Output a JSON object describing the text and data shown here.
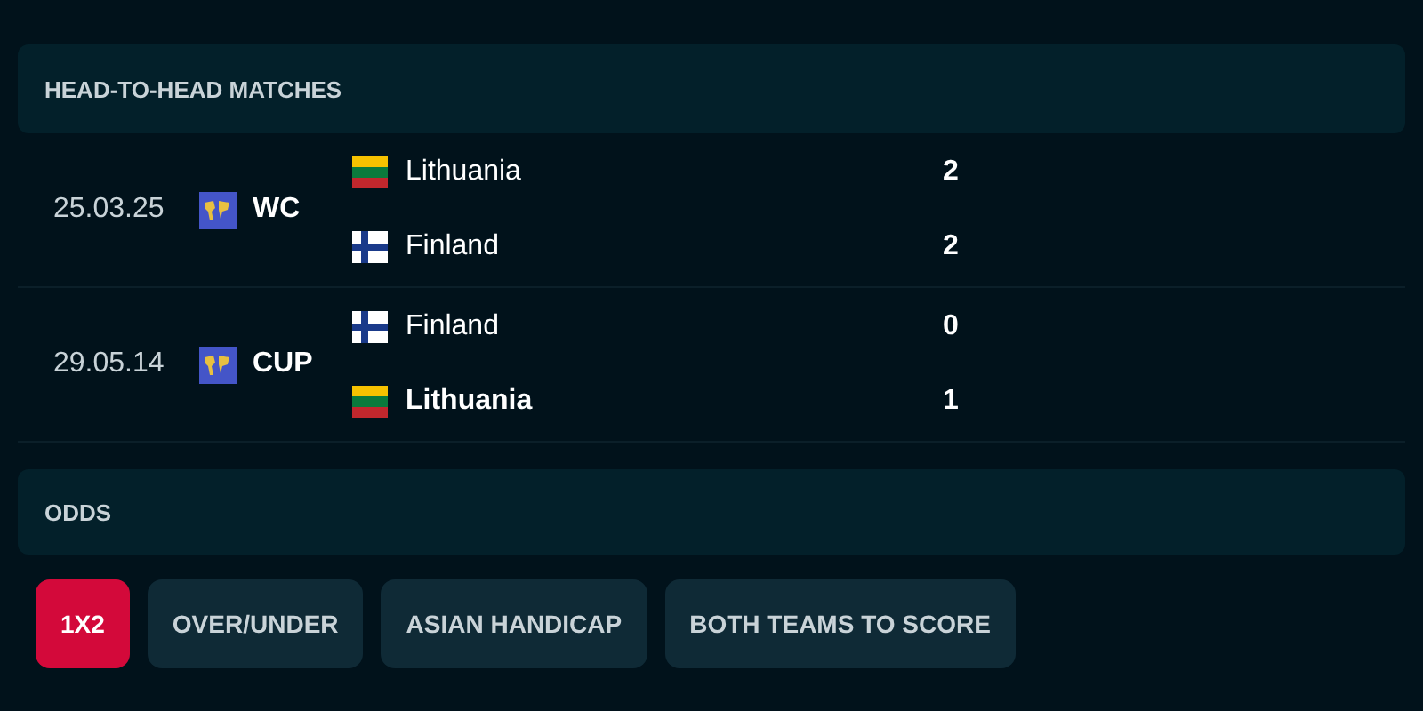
{
  "head_to_head": {
    "title": "HEAD-TO-HEAD MATCHES",
    "matches": [
      {
        "date": "25.03.25",
        "competition": "WC",
        "teams": [
          {
            "name": "Lithuania",
            "kind": "lithuania",
            "score": "2",
            "winner": false
          },
          {
            "name": "Finland",
            "kind": "finland",
            "score": "2",
            "winner": false
          }
        ]
      },
      {
        "date": "29.05.14",
        "competition": "CUP",
        "teams": [
          {
            "name": "Finland",
            "kind": "finland",
            "score": "0",
            "winner": false
          },
          {
            "name": "Lithuania",
            "kind": "lithuania",
            "score": "1",
            "winner": true
          }
        ]
      }
    ]
  },
  "odds": {
    "title": "ODDS",
    "tabs": [
      {
        "label": "1X2",
        "selected": true
      },
      {
        "label": "OVER/UNDER",
        "selected": false
      },
      {
        "label": "ASIAN HANDICAP",
        "selected": false
      },
      {
        "label": "BOTH TEAMS TO SCORE",
        "selected": false
      }
    ]
  }
}
